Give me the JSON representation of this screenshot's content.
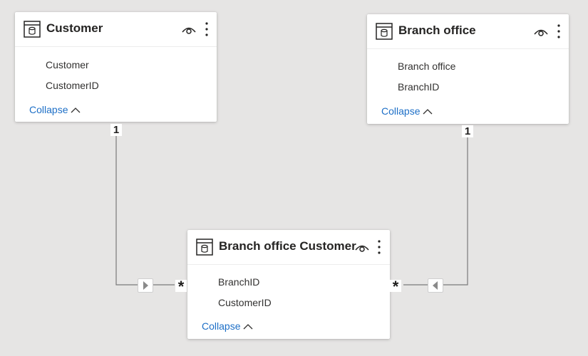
{
  "tables": {
    "customer": {
      "title": "Customer",
      "fields": [
        "Customer",
        "CustomerID"
      ],
      "collapse_label": "Collapse"
    },
    "branch_office": {
      "title": "Branch office",
      "fields": [
        "Branch office",
        "BranchID"
      ],
      "collapse_label": "Collapse"
    },
    "branch_office_customer": {
      "title": "Branch office Customer",
      "fields": [
        "BranchID",
        "CustomerID"
      ],
      "collapse_label": "Collapse"
    }
  },
  "relationships": [
    {
      "from": "Customer",
      "to": "Branch office Customer",
      "from_cardinality": "1",
      "to_cardinality": "*",
      "direction": "right"
    },
    {
      "from": "Branch office",
      "to": "Branch office Customer",
      "from_cardinality": "1",
      "to_cardinality": "*",
      "direction": "left"
    }
  ],
  "icons": {
    "table": "table-icon",
    "visibility": "eye-icon",
    "menu": "more-icon",
    "collapse": "chevron-up-icon",
    "filter_direction": "triangle-arrow-icon"
  },
  "colors": {
    "canvas": "#e6e5e4",
    "card": "#ffffff",
    "link": "#1d6fc7",
    "connector": "#7a7a7a",
    "text": "#252423"
  }
}
